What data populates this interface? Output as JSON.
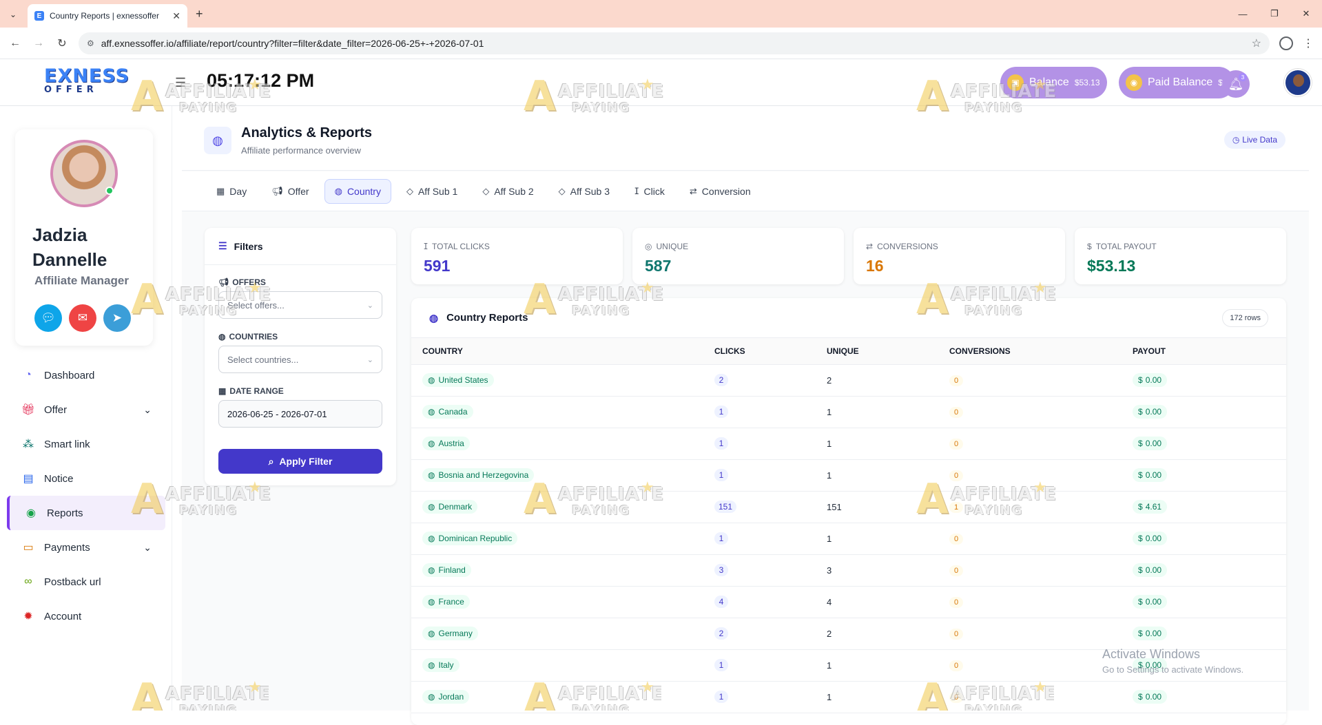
{
  "browser": {
    "tab_title": "Country Reports | exnessoffer",
    "url": "aff.exnessoffer.io/affiliate/report/country?filter=filter&date_filter=2026-06-25+-+2026-07-01"
  },
  "topbar": {
    "logo_line1": "EXNESS",
    "logo_line2": "OFFER",
    "clock": "05:17:12 PM",
    "balance_label": "Balance",
    "balance_amount": "$53.13",
    "paid_label": "Paid Balance",
    "paid_amount": "$0",
    "notif_count": "3"
  },
  "profile": {
    "first_name": "Jadzia",
    "last_name": "Dannelle",
    "role": "Affiliate Manager"
  },
  "menu": [
    {
      "label": "Dashboard",
      "icon": "dashboard-icon"
    },
    {
      "label": "Offer",
      "icon": "gift-icon",
      "has_children": true
    },
    {
      "label": "Smart link",
      "icon": "link-grid-icon"
    },
    {
      "label": "Notice",
      "icon": "notice-icon"
    },
    {
      "label": "Reports",
      "icon": "reports-icon",
      "active": true
    },
    {
      "label": "Payments",
      "icon": "payments-icon",
      "has_children": true
    },
    {
      "label": "Postback url",
      "icon": "chain-icon"
    },
    {
      "label": "Account",
      "icon": "account-icon"
    }
  ],
  "header": {
    "title": "Analytics & Reports",
    "subtitle": "Affiliate performance overview",
    "live": "Live Data"
  },
  "tabs": [
    {
      "label": "Day"
    },
    {
      "label": "Offer"
    },
    {
      "label": "Country",
      "active": true
    },
    {
      "label": "Aff Sub 1"
    },
    {
      "label": "Aff Sub 2"
    },
    {
      "label": "Aff Sub 3"
    },
    {
      "label": "Click"
    },
    {
      "label": "Conversion"
    }
  ],
  "filters": {
    "title": "Filters",
    "offers_label": "OFFERS",
    "offers_placeholder": "Select offers...",
    "countries_label": "COUNTRIES",
    "countries_placeholder": "Select countries...",
    "date_label": "DATE RANGE",
    "date_value": "2026-06-25 - 2026-07-01",
    "apply": "Apply Filter"
  },
  "stats": {
    "clicks_label": "TOTAL CLICKS",
    "clicks": "591",
    "unique_label": "UNIQUE",
    "unique": "587",
    "conv_label": "CONVERSIONS",
    "conv": "16",
    "payout_label": "TOTAL PAYOUT",
    "payout": "$53.13"
  },
  "report": {
    "title": "Country Reports",
    "rows_count": "172 rows",
    "columns": [
      "COUNTRY",
      "CLICKS",
      "UNIQUE",
      "CONVERSIONS",
      "PAYOUT"
    ],
    "rows": [
      {
        "country": "United States",
        "clicks": "2",
        "unique": "2",
        "conv": "0",
        "payout": "0.00"
      },
      {
        "country": "Canada",
        "clicks": "1",
        "unique": "1",
        "conv": "0",
        "payout": "0.00"
      },
      {
        "country": "Austria",
        "clicks": "1",
        "unique": "1",
        "conv": "0",
        "payout": "0.00"
      },
      {
        "country": "Bosnia and Herzegovina",
        "clicks": "1",
        "unique": "1",
        "conv": "0",
        "payout": "0.00"
      },
      {
        "country": "Denmark",
        "clicks": "151",
        "unique": "151",
        "conv": "1",
        "payout": "4.61"
      },
      {
        "country": "Dominican Republic",
        "clicks": "1",
        "unique": "1",
        "conv": "0",
        "payout": "0.00"
      },
      {
        "country": "Finland",
        "clicks": "3",
        "unique": "3",
        "conv": "0",
        "payout": "0.00"
      },
      {
        "country": "France",
        "clicks": "4",
        "unique": "4",
        "conv": "0",
        "payout": "0.00"
      },
      {
        "country": "Germany",
        "clicks": "2",
        "unique": "2",
        "conv": "0",
        "payout": "0.00"
      },
      {
        "country": "Italy",
        "clicks": "1",
        "unique": "1",
        "conv": "0",
        "payout": "0.00"
      },
      {
        "country": "Jordan",
        "clicks": "1",
        "unique": "1",
        "conv": "0",
        "payout": "0.00"
      }
    ]
  },
  "watermark": {
    "line1": "AFFILIATE",
    "line2": "PAYING"
  },
  "os_notice": {
    "line1": "Activate Windows",
    "line2": "Go to Settings to activate Windows."
  },
  "colors": {
    "accent": "#4338ca",
    "balance_pill": "#b392e6",
    "stat_clicks": "#4338ca",
    "stat_unique": "#0f766e",
    "stat_conv": "#d97706",
    "stat_payout": "#047857"
  }
}
